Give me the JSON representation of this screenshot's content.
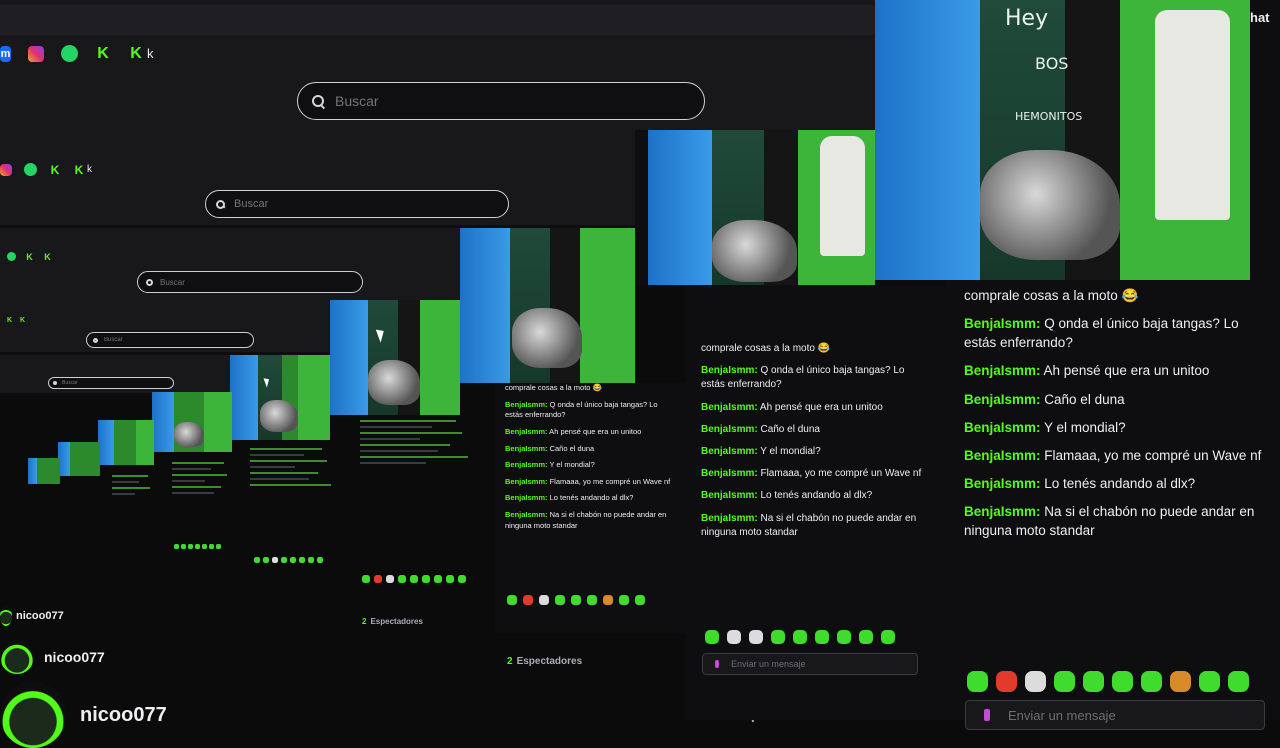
{
  "topbar": {
    "search_placeholder": "Buscar",
    "chat_label": "hat",
    "kick_suffix": "k"
  },
  "icons": {
    "social": [
      "messenger-icon",
      "instagram-icon",
      "whatsapp-icon",
      "kick-icon",
      "kick-icon"
    ],
    "m_glyph": "m",
    "k_glyph": "K"
  },
  "chat": {
    "prev_message": "comprale cosas a la moto 😂",
    "messages": [
      {
        "user": "BenjaIsmm:",
        "text": " Q onda el único baja tangas? Lo estás enferrando?"
      },
      {
        "user": "BenjaIsmm:",
        "text": " Ah pensé que era un unitoo"
      },
      {
        "user": "BenjaIsmm:",
        "text": " Caño el duna"
      },
      {
        "user": "BenjaIsmm:",
        "text": " Y el mondial?"
      },
      {
        "user": "BenjaIsmm:",
        "text": " Flamaaa, yo me compré un Wave nf"
      },
      {
        "user": "BenjaIsmm:",
        "text": " Lo tenés andando al dlx?"
      },
      {
        "user": "BenjaIsmm:",
        "text": " Na si el chabón no puede andar en ninguna moto standar"
      }
    ],
    "input_placeholder": "Enviar un mensaje",
    "viewers_count": "2",
    "viewers_label": "Espectadores"
  },
  "video": {
    "wall_text_1": "Hey",
    "wall_text_2": "BOS",
    "wall_text_3": "HEMONITOS"
  },
  "streamer": {
    "name": "nicoo077"
  },
  "colors": {
    "kick_green": "#53fc18",
    "bg": "#0e0e10",
    "bar": "#18181b"
  }
}
